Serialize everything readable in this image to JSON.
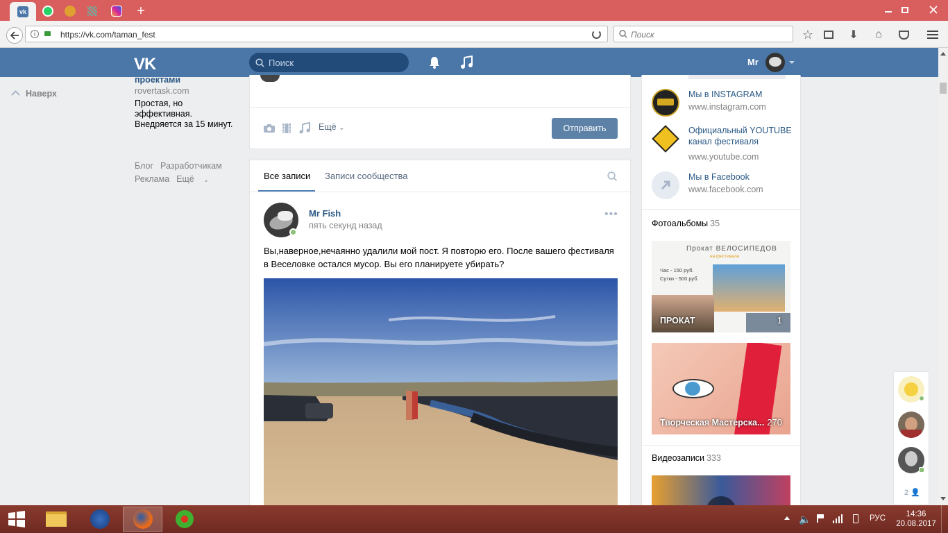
{
  "browser": {
    "url": "https://vk.com/taman_fest",
    "search_placeholder": "Поиск",
    "tabs": [
      "vk",
      "whatsapp",
      "tab-3",
      "tab-4",
      "instagram"
    ]
  },
  "vk_header": {
    "search_placeholder": "Поиск",
    "user_name": "Mr"
  },
  "left": {
    "up_label": "Наверх",
    "ad": {
      "title": "проектами",
      "url": "rovertask.com",
      "text": "Простая, но эффективная. Внедряется за 15 минут."
    },
    "footer": [
      "Блог",
      "Разработчикам",
      "Реклама",
      "Ещё"
    ]
  },
  "composer": {
    "more_label": "Ещё",
    "send_label": "Отправить"
  },
  "feed": {
    "tabs": [
      "Все записи",
      "Записи сообщества"
    ],
    "post": {
      "author": "Mr Fish",
      "time": "пять секунд назад",
      "text": "Вы,наверное,нечаянно удалили мой пост. Я повторю его. После вашего фестиваля в Веселовке остался мусор. Вы его планируете убирать?"
    }
  },
  "right": {
    "links": [
      {
        "title": "Мы в INSTAGRAM",
        "url": "www.instagram.com"
      },
      {
        "title": "Официальный YOUTUBE канал фестиваля",
        "url": "www.youtube.com"
      },
      {
        "title": "Мы в Facebook",
        "url": "www.facebook.com"
      }
    ],
    "albums_label": "Фотоальбомы",
    "albums_count": "35",
    "albums": [
      {
        "title": "ПРОКАТ",
        "count": "1",
        "poster_line1": "Прокат ВЕЛОСИПЕДОВ",
        "poster_line2": "на фестивале",
        "poster_line3": "Час - 150 руб.",
        "poster_line4": "Сутки - 500 руб."
      },
      {
        "title": "Творческая Мастерска...",
        "count": "270"
      }
    ],
    "videos_label": "Видеозаписи",
    "videos_count": "333"
  },
  "chats": {
    "count": "2"
  },
  "taskbar": {
    "lang": "РУС",
    "time": "14:36",
    "date": "20.08.2017"
  }
}
